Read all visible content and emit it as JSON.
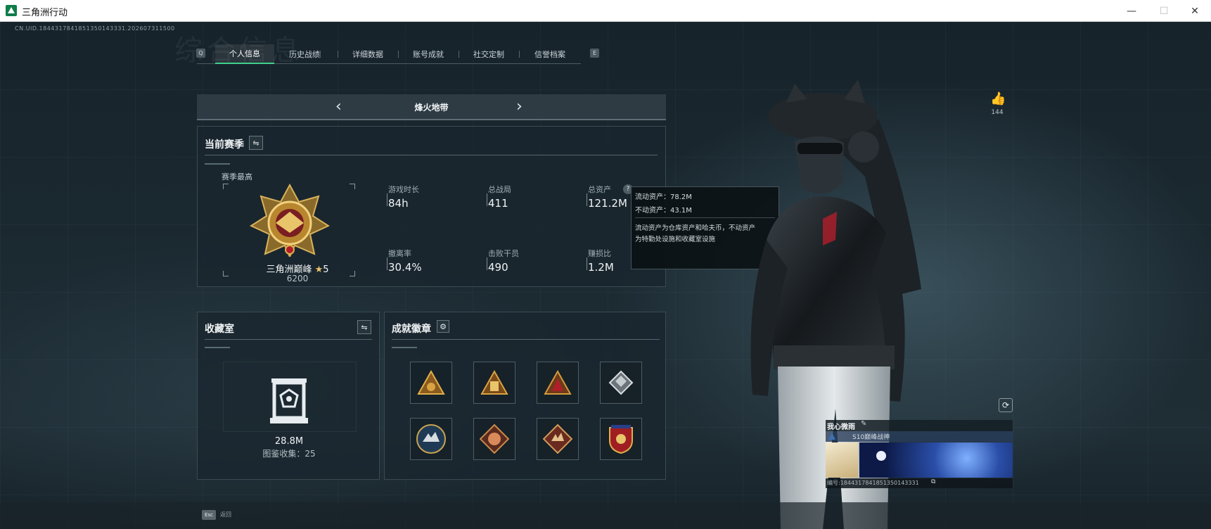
{
  "window": {
    "title": "三角洲行动",
    "minimize": "—",
    "maximize": "☐",
    "close": "✕"
  },
  "uid_text": "CN.UID.1844317841851350143331.202607311500",
  "background_title": "综合信息",
  "tabs": {
    "left_key": "Q",
    "right_key": "E",
    "items": [
      {
        "label": "个人信息"
      },
      {
        "label": "历史战绩"
      },
      {
        "label": "详细数据"
      },
      {
        "label": "账号成就"
      },
      {
        "label": "社交定制"
      },
      {
        "label": "信誉档案"
      }
    ]
  },
  "mode": {
    "label": "烽火地带",
    "prev": "‹",
    "next": "›"
  },
  "season": {
    "heading": "当前赛季",
    "peak_label": "赛季最高",
    "rank_name": "三角洲巅峰",
    "rank_stars": "5",
    "rank_points": "6200",
    "stats": [
      {
        "label": "游戏时长",
        "value": "84h"
      },
      {
        "label": "总战局",
        "value": "411"
      },
      {
        "label": "总资产",
        "value": "121.2M"
      },
      {
        "label": "撤离率",
        "value": "30.4%"
      },
      {
        "label": "击败干员",
        "value": "490"
      },
      {
        "label": "赚损比",
        "value": "1.2M"
      }
    ]
  },
  "tooltip": {
    "liquid": "流动资产：78.2M",
    "fixed": "不动资产：43.1M",
    "desc1": "流动资产为仓库资产和哈夫币，不动资产",
    "desc2": "为特勤处设施和收藏室设施"
  },
  "collection": {
    "heading": "收藏室",
    "value": "28.8M",
    "catalog": "图鉴收集：25"
  },
  "achievements": {
    "heading": "成就徽章",
    "badges": [
      "badge-triangle-gold",
      "badge-triangle-tower",
      "badge-triangle-peak",
      "badge-cube-silver",
      "badge-wolf-blue",
      "badge-dragon-red",
      "badge-wolf-red",
      "badge-eagle-shield"
    ]
  },
  "likes": {
    "count": "144"
  },
  "profile_card": {
    "name": "我心微雨",
    "title": "S10巅峰战神",
    "id_text": "编号:1844317841851350143331"
  },
  "footer": {
    "esc_key": "Esc",
    "back_label": "返回"
  },
  "colors": {
    "accent_green": "#3fd18a",
    "panel_bg": "#1a262e"
  }
}
